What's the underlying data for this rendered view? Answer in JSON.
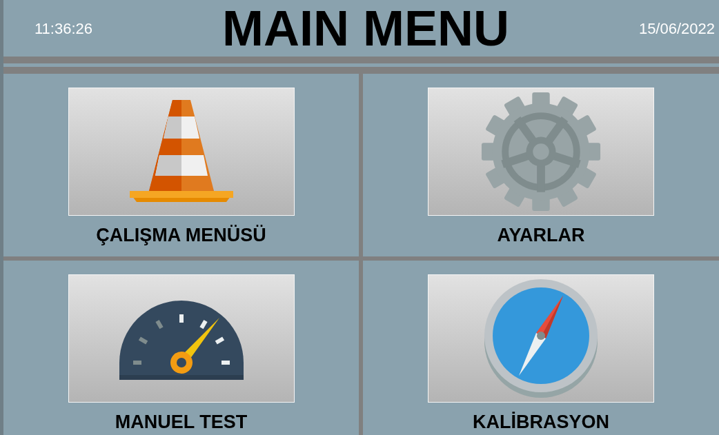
{
  "header": {
    "time": "11:36:26",
    "title": "MAIN MENU",
    "date": "15/06/2022"
  },
  "menu": [
    {
      "kind": "cone",
      "label": "ÇALIŞMA MENÜSÜ"
    },
    {
      "kind": "gear",
      "label": "AYARLAR"
    },
    {
      "kind": "gauge",
      "label": "MANUEL TEST"
    },
    {
      "kind": "compass",
      "label": "KALİBRASYON"
    }
  ]
}
